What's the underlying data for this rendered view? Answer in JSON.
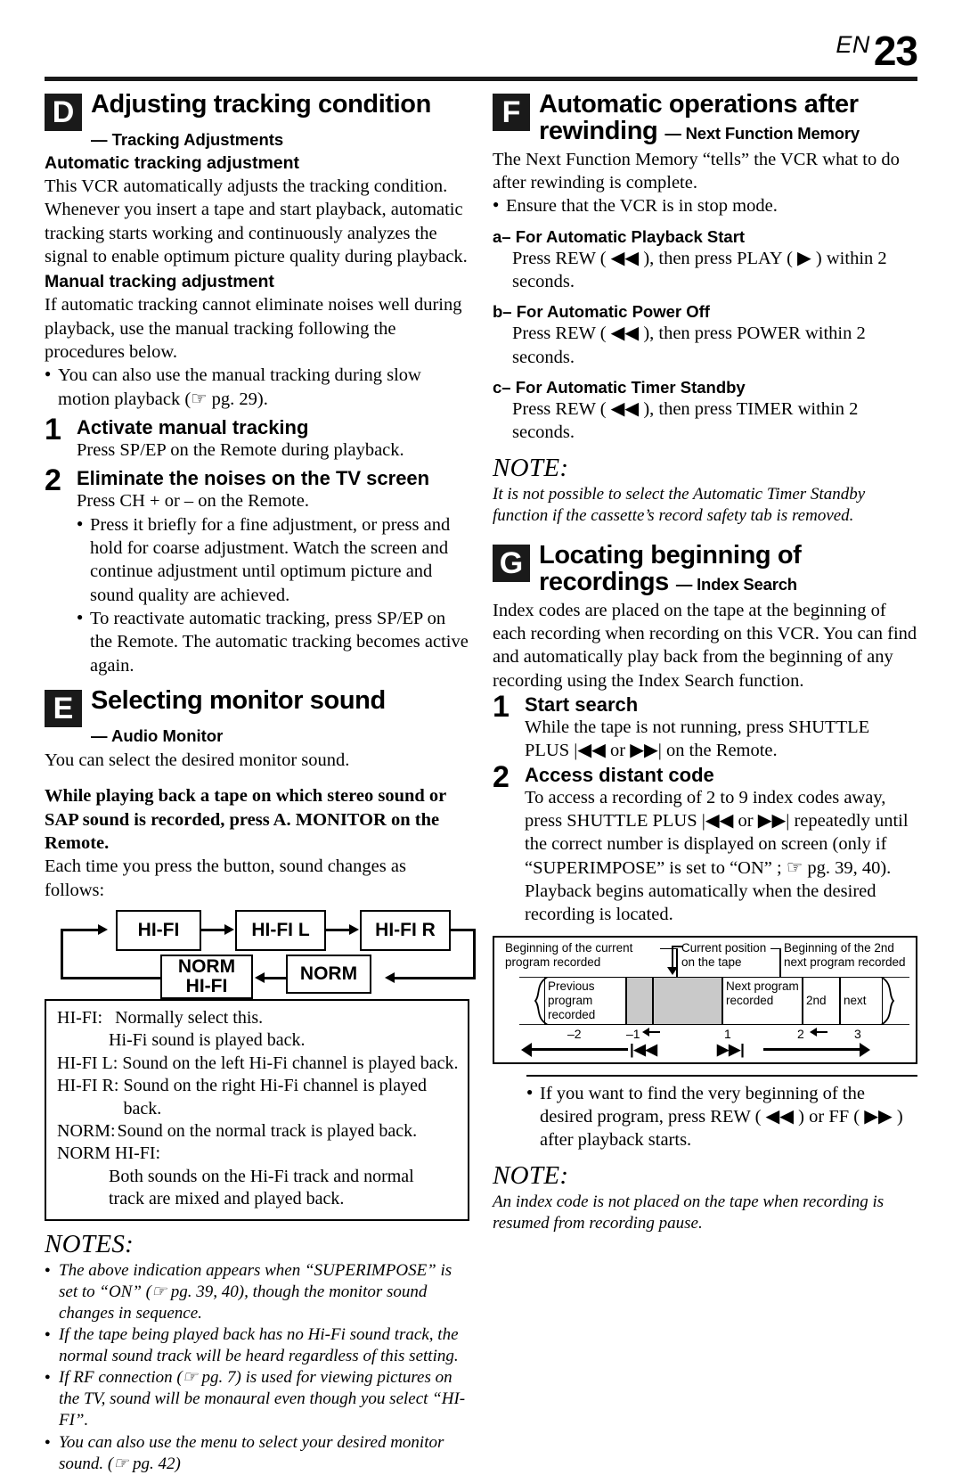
{
  "header": {
    "en_label": "EN",
    "page_number": "23"
  },
  "left": {
    "section_d": {
      "badge": "D",
      "title": "Adjusting tracking condition",
      "subtitle": "— Tracking Adjustments",
      "auto_head": "Automatic tracking adjustment",
      "auto_body": "This VCR automatically adjusts the tracking condition. Whenever you insert a tape and start playback, automatic tracking starts working and continuously analyzes the signal to enable optimum picture quality during playback.",
      "manual_head": "Manual tracking adjustment",
      "manual_body": "If automatic tracking cannot eliminate noises well during playback, use the manual tracking following the procedures below.",
      "manual_bullet": "You can also use the manual tracking during slow motion playback (☞ pg. 29).",
      "steps": [
        {
          "num": "1",
          "title": "Activate manual tracking",
          "body": "Press SP/EP on the Remote during playback.",
          "bullets": []
        },
        {
          "num": "2",
          "title": "Eliminate the noises on the TV screen",
          "body": "Press CH + or – on the Remote.",
          "bullets": [
            "Press it briefly for a fine adjustment, or press and hold for coarse adjustment. Watch the screen and continue adjustment until optimum picture and sound quality are achieved.",
            "To reactivate automatic tracking, press SP/EP on the Remote. The automatic tracking becomes active again."
          ]
        }
      ]
    },
    "section_e": {
      "badge": "E",
      "title": "Selecting monitor sound",
      "subtitle": "— Audio Monitor",
      "intro": "You can select the desired monitor sound.",
      "instruction_bold": "While playing back a tape on which stereo sound or SAP sound is recorded, press A. MONITOR on the Remote.",
      "instruction_plain": "Each time you press the button, sound changes as follows:",
      "flow": {
        "boxes": [
          "HI-FI",
          "HI-FI L",
          "HI-FI R",
          "NORM",
          "NORM HI-FI"
        ],
        "norm_hifi_line1": "NORM",
        "norm_hifi_line2": "HI-FI"
      },
      "legend": [
        {
          "key": "HI-FI:",
          "lines": [
            "Normally select this.",
            "Hi-Fi sound is played back."
          ],
          "indent": true
        },
        {
          "key": "HI-FI L:",
          "lines": [
            "Sound on the left Hi-Fi channel is played back."
          ],
          "indent": false
        },
        {
          "key": "HI-FI R:",
          "lines": [
            "Sound on the right Hi-Fi channel is played back."
          ],
          "indent": false
        },
        {
          "key": "NORM:",
          "lines": [
            "Sound on the normal track is played back."
          ],
          "indent": false
        },
        {
          "key": "NORM  HI-FI:",
          "lines": [
            "Both sounds on the Hi-Fi track and normal",
            "track are mixed and played back."
          ],
          "indent": true
        }
      ],
      "notes_title": "NOTES:",
      "notes": [
        "The above indication appears when “SUPERIMPOSE” is set to “ON” (☞ pg. 39, 40), though the monitor sound changes in sequence.",
        "If the tape being played back has no Hi-Fi sound track, the normal sound track will be heard regardless of this setting.",
        "If RF connection (☞ pg. 7) is used for viewing pictures on the TV, sound will be monaural even though you select “HI-FI”.",
        "You can also use the menu to select your desired monitor sound. (☞ pg. 42)"
      ]
    }
  },
  "right": {
    "section_f": {
      "badge": "F",
      "title_line1": "Automatic operations after",
      "title_line2": "rewinding",
      "subtitle": "— Next Function Memory",
      "intro": "The Next Function Memory “tells” the VCR what to do after rewinding is complete.",
      "intro_bullet": "Ensure that the VCR is in stop mode.",
      "items": [
        {
          "label": "a–  For Automatic Playback Start",
          "body": "Press REW ( ◀◀ ), then press PLAY ( ▶ ) within 2 seconds."
        },
        {
          "label": "b–  For Automatic Power Off",
          "body": "Press REW ( ◀◀ ), then press POWER within 2 seconds."
        },
        {
          "label": "c–  For Automatic Timer Standby",
          "body": "Press REW ( ◀◀ ), then press TIMER within 2 seconds."
        }
      ],
      "note_title": "NOTE:",
      "note_body": "It is not possible to select the Automatic Timer Standby function if the cassette’s record safety tab is removed."
    },
    "section_g": {
      "badge": "G",
      "title_line1": "Locating beginning of",
      "title_line2": "recordings",
      "subtitle": "— Index Search",
      "intro": "Index codes are placed on the tape at the beginning of each recording when recording on this VCR. You can find and automatically play back from the beginning of any recording using the Index Search function.",
      "steps": [
        {
          "num": "1",
          "title": "Start search",
          "body": "While the tape is not running, press SHUTTLE PLUS |◀◀ or ▶▶| on the Remote."
        },
        {
          "num": "2",
          "title": "Access distant code",
          "body": "To access a recording of 2 to 9 index codes away, press SHUTTLE PLUS |◀◀ or ▶▶| repeatedly until the correct number is displayed on screen (only if “SUPERIMPOSE” is set to “ON” ; ☞ pg. 39, 40). Playback begins automatically when the desired recording is located."
        }
      ],
      "diagram": {
        "callout_left": "Beginning of the current program recorded",
        "callout_center": "Current position on the tape",
        "callout_right": "Beginning of the 2nd next program recorded",
        "segments": [
          "Previous program recorded",
          "",
          "",
          "Next program recorded",
          "2nd",
          "next"
        ],
        "ticks": [
          "–2",
          "–1",
          "1",
          "2",
          "3"
        ],
        "rew_symbol": "|◀◀",
        "ff_symbol": "▶▶|"
      },
      "final_bullet": "If you want to find the very beginning of the desired program, press REW ( ◀◀ ) or FF ( ▶▶ ) after playback starts.",
      "note_title": "NOTE:",
      "note_body": "An index code is not placed on the tape when recording is resumed from recording pause."
    }
  }
}
